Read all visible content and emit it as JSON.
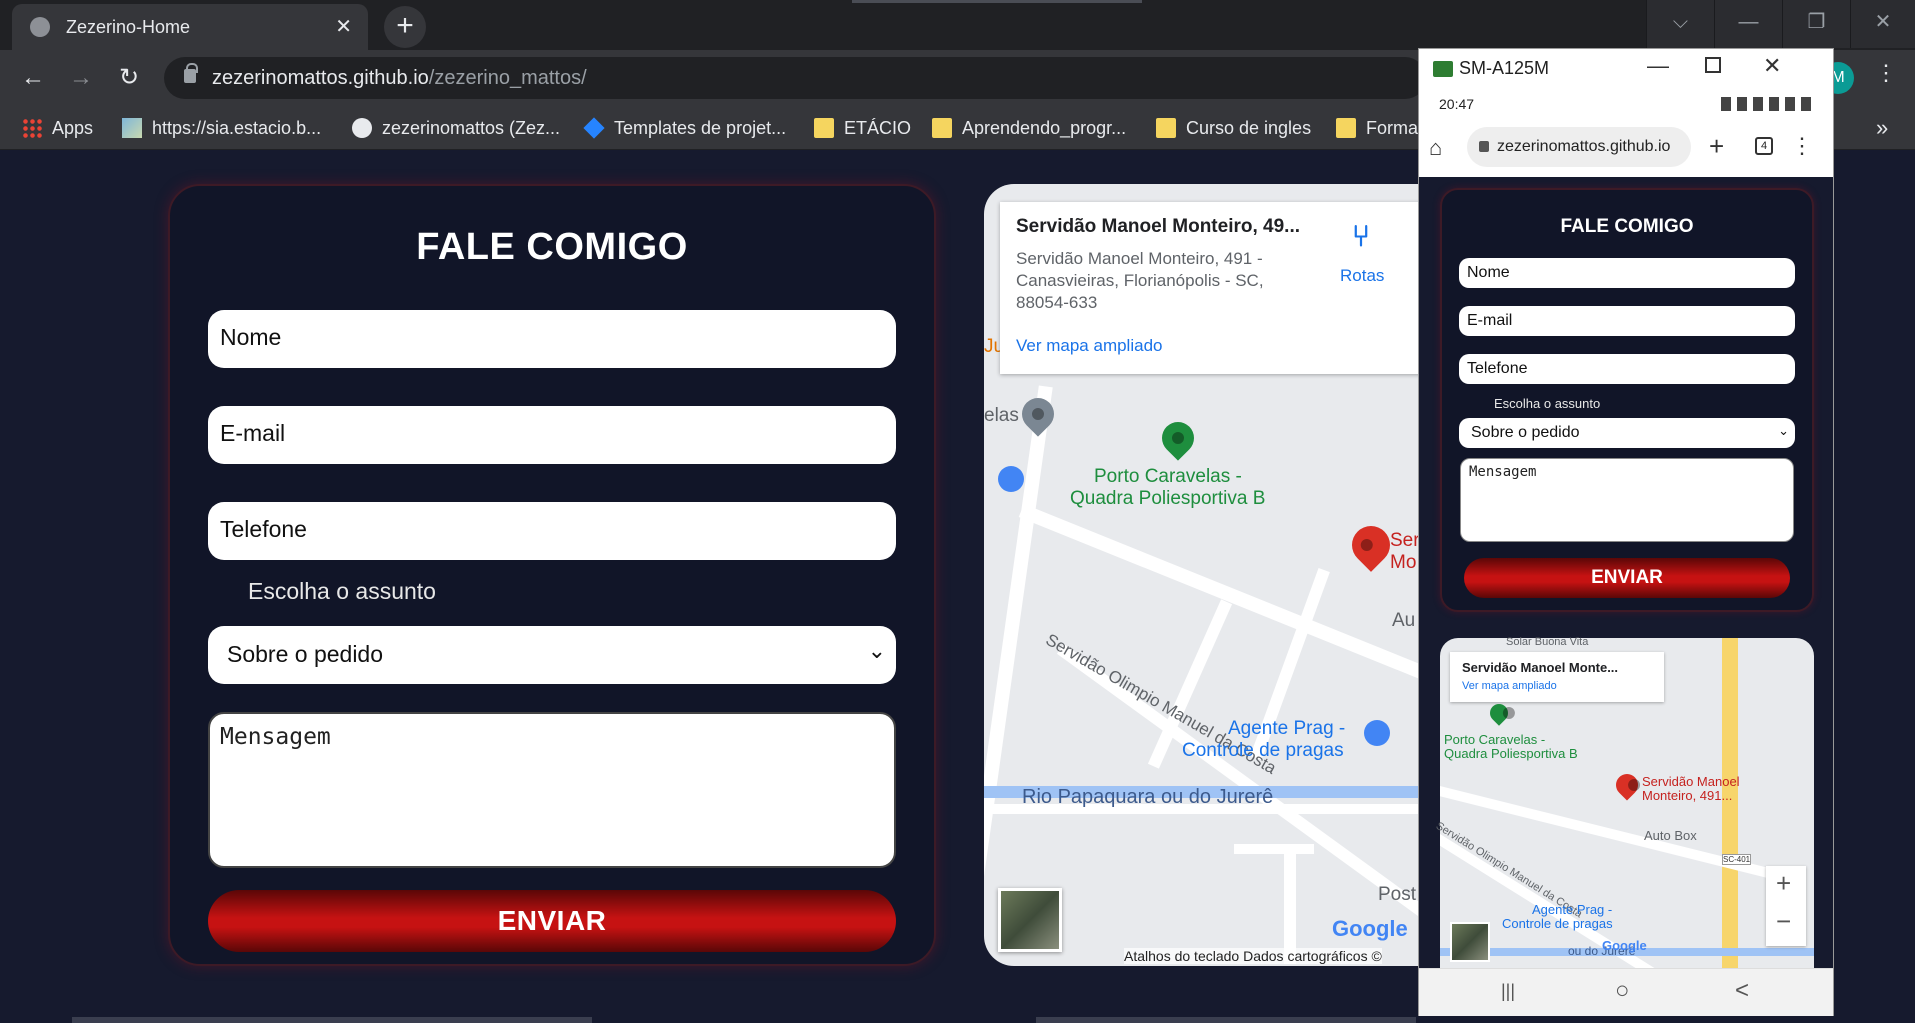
{
  "browser": {
    "tab_title": "Zezerino-Home",
    "close_glyph": "✕",
    "newtab_glyph": "+",
    "url_host": "zezerinomattos.github.io",
    "url_path": "/zezerino_mattos/",
    "profile_initial": "M",
    "back_glyph": "←",
    "forward_glyph": "→",
    "reload_glyph": "↻",
    "menu_glyph": "⋮",
    "window_controls": [
      "⌵",
      "—",
      "❐",
      "✕"
    ],
    "bookmarks": [
      {
        "label": "Apps",
        "icon": "apps-grid-icon"
      },
      {
        "label": "https://sia.estacio.b...",
        "icon": "site-icon"
      },
      {
        "label": "zezerinomattos (Zez...",
        "icon": "github-icon"
      },
      {
        "label": "Templates de projet...",
        "icon": "diamond-icon"
      },
      {
        "label": "ETÁCIO",
        "icon": "folder-icon"
      },
      {
        "label": "Aprendendo_progr...",
        "icon": "folder-icon"
      },
      {
        "label": "Curso de ingles",
        "icon": "folder-icon"
      },
      {
        "label": "Forma",
        "icon": "folder-icon"
      }
    ],
    "bookmarks_more": "»"
  },
  "form": {
    "title": "FALE COMIGO",
    "name_placeholder": "Nome",
    "email_placeholder": "E-mail",
    "phone_placeholder": "Telefone",
    "subject_label": "Escolha o assunto",
    "subject_selected": "Sobre o pedido",
    "message_placeholder": "Mensagem",
    "send_label": "ENVIAR",
    "chevron": "⌄"
  },
  "map": {
    "card_title": "Servidão Manoel Monteiro, 49...",
    "card_address": "Servidão Manoel Monteiro, 491 - Canasvieiras, Florianópolis - SC, 88054-633",
    "card_link": "Ver mapa ampliado",
    "directions": "Rotas",
    "labels": {
      "velas": "elas",
      "ju": "Ju",
      "porto": "Porto Caravelas -",
      "quadra": "Quadra Poliesportiva B",
      "street": "Servidão Olimpio Manuel da Costa",
      "agente": "Agente Prag -",
      "controle": "Controle de pragas",
      "river": "Rio Papaquara ou do Jurerê",
      "ser": "Ser",
      "mo": "Mo",
      "au": "Au",
      "post": "Post",
      "google": "Google"
    },
    "footer": "Atalhos do teclado    Dados cartográficos ©"
  },
  "phone": {
    "device": "SM-A125M",
    "time": "20:47",
    "url": "zezerinomattos.github.io",
    "tab_count": "4",
    "form_title": "FALE COMIGO",
    "name": "Nome",
    "email": "E-mail",
    "phone": "Telefone",
    "subject_label": "Escolha o assunto",
    "subject_selected": "Sobre o pedido",
    "message": "Mensagem",
    "send": "ENVIAR",
    "map_title": "Servidão Manoel Monte...",
    "map_link": "Ver mapa ampliado",
    "map_porto": "Porto Caravelas -",
    "map_quadra": "Quadra Poliesportiva B",
    "map_pin": "Servidão Manoel",
    "map_pin2": "Monteiro, 491...",
    "map_autobox": "Auto Box",
    "map_agente": "Agente Prag -",
    "map_controle": "Controle de pragas",
    "map_street": "Servidão Olimpio Manuel da Costa",
    "map_river": "ou do Jurerê",
    "map_google": "Google",
    "map_sc401": "SC-401",
    "map_solar": "Solar Buona Vita",
    "zoom_in": "+",
    "zoom_out": "−",
    "nav_recent": "|||",
    "nav_home": "○",
    "nav_back": "<"
  }
}
